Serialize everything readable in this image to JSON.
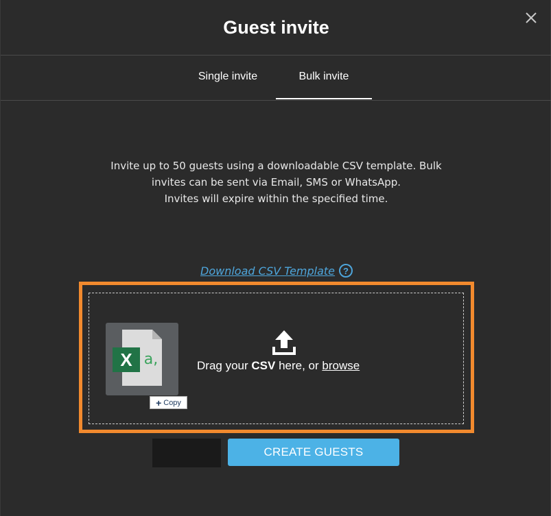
{
  "dialog": {
    "title": "Guest invite"
  },
  "tabs": [
    {
      "label": "Single invite",
      "active": false
    },
    {
      "label": "Bulk invite",
      "active": true
    }
  ],
  "description": {
    "line1": "Invite up to 50 guests using a downloadable CSV template. Bulk",
    "line2": "invites can be sent via Email, SMS or WhatsApp.",
    "line3": "Invites will expire within the specified time."
  },
  "download": {
    "label": "Download CSV Template",
    "help_glyph": "?"
  },
  "dropzone": {
    "prefix": "Drag your ",
    "format": "CSV",
    "middle": " here, or ",
    "browse": "browse",
    "file_icon_letter": "X",
    "file_icon_text": "a,",
    "copy_tag_glyph": "+",
    "copy_tag_label": "Copy"
  },
  "actions": {
    "create_label": "CREATE GUESTS"
  },
  "colors": {
    "background": "#2b2b2b",
    "accent_blue": "#4cb2e6",
    "link_blue": "#4ea6dc",
    "highlight_orange": "#f28a2e",
    "excel_green": "#217346"
  },
  "icons": {
    "close": "close-icon",
    "help": "question-circle-icon",
    "upload": "upload-icon",
    "file": "excel-file-icon"
  }
}
